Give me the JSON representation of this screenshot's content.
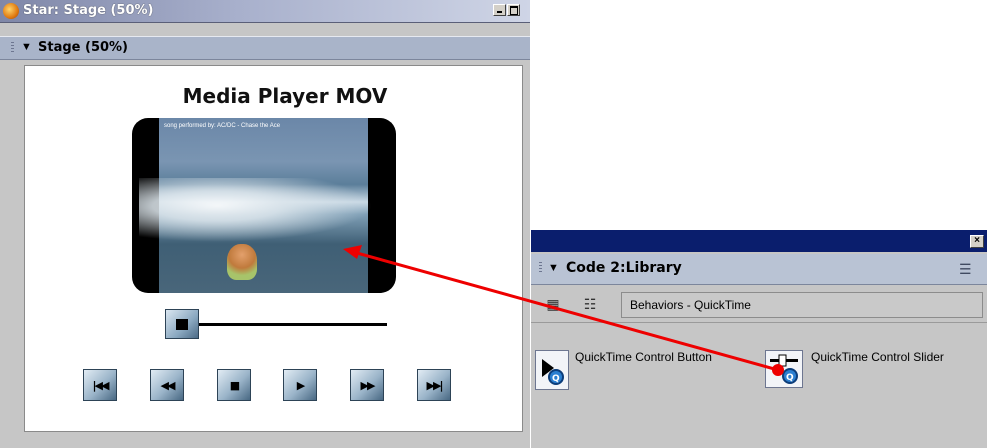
{
  "stage_window": {
    "title": "Star: Stage (50%)",
    "panel_label": "Stage (50%)",
    "stage_title": "Media Player MOV",
    "video_caption": "song performed by: AC/DC - Chase the Ace",
    "controls": [
      {
        "name": "go-to-start",
        "glyph": "|◀◀"
      },
      {
        "name": "rewind",
        "glyph": "◀◀"
      },
      {
        "name": "stop",
        "glyph": "■"
      },
      {
        "name": "play",
        "glyph": "▶"
      },
      {
        "name": "fast-forward",
        "glyph": "▶▶"
      },
      {
        "name": "go-to-end",
        "glyph": "▶▶|"
      }
    ]
  },
  "library_window": {
    "close_glyph": "×",
    "panel_label": "Code 2:Library",
    "category": "Behaviors - QuickTime",
    "items": [
      {
        "label": "QuickTime Control Button",
        "icon": "quicktime-button-icon"
      },
      {
        "label": "QuickTime Control Slider",
        "icon": "quicktime-slider-icon"
      }
    ]
  },
  "annotation": {
    "arrow_color": "#ee0000"
  },
  "colors": {
    "stage_title_bar": "#a8b0cc",
    "library_title_bar": "#0a1e6d",
    "panel_header": "#a9b4c9"
  }
}
